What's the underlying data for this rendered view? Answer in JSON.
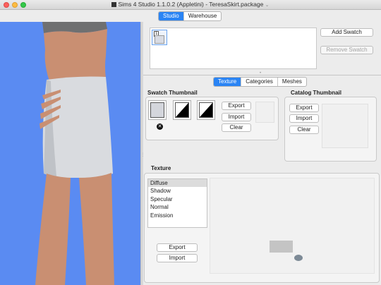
{
  "window": {
    "title": "Sims 4 Studio 1.1.0.2 (Appletini)",
    "separator": " - ",
    "document": "TeresaSkirt.package",
    "app_icon": "sims4studio-icon"
  },
  "top_tabs": [
    "Studio",
    "Warehouse"
  ],
  "top_tabs_active": "Studio",
  "swatches": {
    "items": [
      {
        "number": "1"
      }
    ],
    "add_label": "Add Swatch",
    "remove_label": "Remove Swatch"
  },
  "mid_tabs": [
    "Texture",
    "Categories",
    "Meshes"
  ],
  "mid_tabs_active": "Texture",
  "swatch_thumbnail": {
    "title": "Swatch Thumbnail",
    "export": "Export",
    "import": "Import",
    "clear": "Clear",
    "remove_icon": "close-icon"
  },
  "catalog_thumbnail": {
    "title": "Catalog Thumbnail",
    "export": "Export",
    "import": "Import",
    "clear": "Clear"
  },
  "texture": {
    "title": "Texture",
    "channels": [
      "Diffuse",
      "Shadow",
      "Specular",
      "Normal",
      "Emission"
    ],
    "selected": "Diffuse",
    "export": "Export",
    "import": "Import"
  },
  "colors": {
    "accent": "#2a84f4",
    "viewport_background": "#5a8bf2"
  }
}
